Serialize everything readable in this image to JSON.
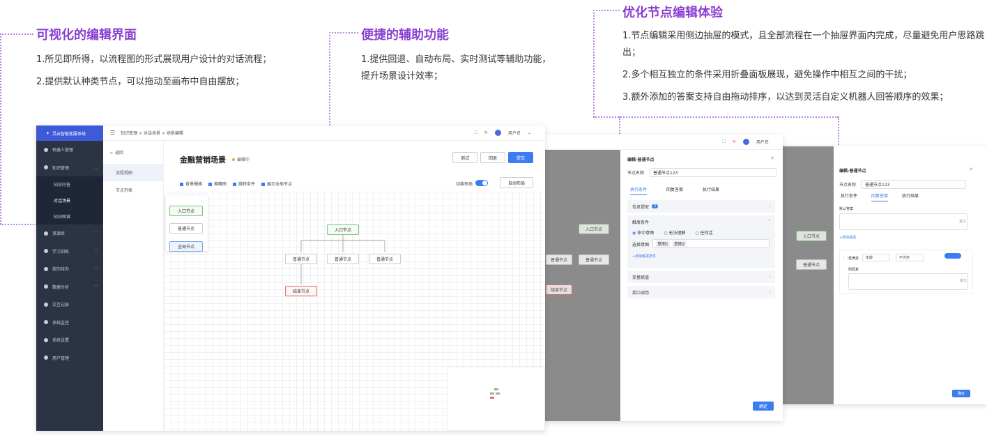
{
  "callouts": {
    "c1": {
      "title": "可视化的编辑界面",
      "lines": [
        "1.所见即所得，以流程图的形式展现用户设计的对话流程；",
        "2.提供默认种类节点，可以拖动至画布中自由摆放；"
      ]
    },
    "c2": {
      "title": "便捷的辅助功能",
      "lines": [
        "1.提供回退、自动布局、实时测试等辅助功能，提升场景设计效率；"
      ]
    },
    "c3": {
      "title": "优化节点编辑体验",
      "lines": [
        "1.节点编辑采用侧边抽屉的模式，且全部流程在一个抽屉界面内完成，尽量避免用户思路跳出；",
        "2.多个相互独立的条件采用折叠面板展现，避免操作中相互之间的干扰；",
        "3.额外添加的答案支持自由拖动排序，以达到灵活自定义机器人回答顺序的效果；"
      ]
    }
  },
  "app": {
    "name": "灵云智能客服系统",
    "breadcrumb": "知识管理 > 对话场景 > 场景编辑",
    "user": "用户名",
    "sidebar": {
      "items": [
        "机器人管理",
        "知识管理",
        "资源库",
        "学习训练",
        "我的待办",
        "数据分析",
        "交互记录",
        "系统监控",
        "系统设置",
        "用户管理"
      ],
      "sub": [
        "知识问答",
        "对话场景",
        "知识图谱"
      ]
    },
    "subnav": {
      "back": "返回",
      "tabs": [
        "流程视图",
        "节点列表"
      ]
    },
    "scene": {
      "title": "金融营销场景",
      "status": "编辑中"
    },
    "buttons": {
      "test": "测试",
      "undo": "回退",
      "submit": "提交",
      "autolayout": "自动布局"
    },
    "checks": [
      "背景栅格",
      "缩略图",
      "跳转条件",
      "展示全局节点"
    ],
    "toggle_label": "切换布局",
    "palette": [
      "入口节点",
      "普通节点",
      "全局节点"
    ],
    "nodes": {
      "entry": "入口节点",
      "normal": "普通节点",
      "end": "结束节点"
    }
  },
  "drawer1": {
    "title": "编辑-普通节点",
    "name_label": "节点名称",
    "name_value": "普通节点123",
    "tabs": [
      "执行条件",
      "回复答案",
      "执行结果"
    ],
    "sections": [
      "信息提取",
      "触发条件",
      "变量赋值",
      "接口调用"
    ],
    "badge": "2",
    "radios": [
      "命中意图",
      "无法理解",
      "任何话"
    ],
    "intent_label": "选择意图",
    "intents": [
      "意图1",
      "意图2"
    ],
    "add_link": "+添加触发条件",
    "ok": "确定"
  },
  "drawer2": {
    "title": "编辑-普通节点",
    "name_label": "节点名称",
    "name_value": "普通节点123",
    "tabs": [
      "执行条件",
      "回复答案",
      "执行结果"
    ],
    "default_label": "默认答案",
    "add_link": "+添加答案",
    "if_label": "若满足",
    "cond1": "年龄",
    "cond2": "不为空",
    "reply_label": "则回复",
    "ok": "确定",
    "rich": "富文"
  },
  "colors": {
    "accent": "#8a3fd1",
    "primary": "#3c7bf0",
    "sidebar": "#2b3345"
  }
}
